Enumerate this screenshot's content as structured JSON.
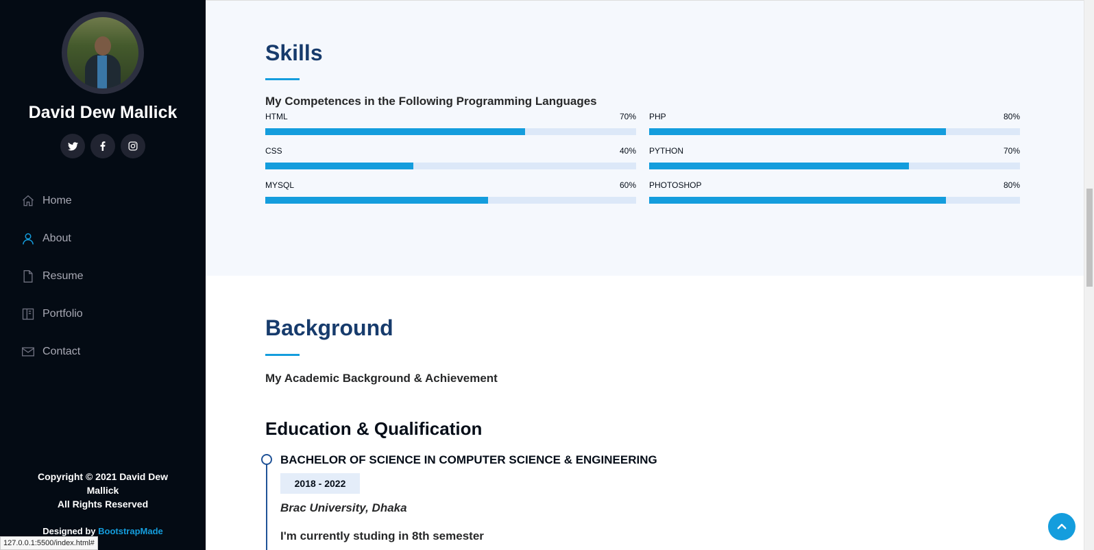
{
  "sidebar": {
    "name": "David Dew Mallick",
    "social": [
      {
        "name": "twitter",
        "glyph": "t"
      },
      {
        "name": "facebook",
        "glyph": "f"
      },
      {
        "name": "instagram",
        "glyph": "◎"
      }
    ],
    "nav": [
      {
        "label": "Home",
        "icon": "house-icon"
      },
      {
        "label": "About",
        "icon": "person-icon",
        "active": true
      },
      {
        "label": "Resume",
        "icon": "file-icon"
      },
      {
        "label": "Portfolio",
        "icon": "book-icon"
      },
      {
        "label": "Contact",
        "icon": "envelope-icon"
      }
    ],
    "copyright_line1": "Copyright © 2021 David Dew",
    "copyright_line2": "Mallick",
    "copyright_line3": "All Rights Reserved",
    "designed_by_prefix": "Designed by ",
    "designed_by_link": "BootstrapMade"
  },
  "skills": {
    "title": "Skills",
    "subtitle": "My Competences in the Following Programming Languages",
    "items": [
      {
        "name": "HTML",
        "percent_label": "70%",
        "level": 0.7
      },
      {
        "name": "PHP",
        "percent_label": "80%",
        "level": 0.8
      },
      {
        "name": "CSS",
        "percent_label": "40%",
        "level": 0.4
      },
      {
        "name": "PYTHON",
        "percent_label": "70%",
        "level": 0.7
      },
      {
        "name": "MYSQL",
        "percent_label": "60%",
        "level": 0.6
      },
      {
        "name": "PHOTOSHOP",
        "percent_label": "80%",
        "level": 0.8
      }
    ]
  },
  "background": {
    "title": "Background",
    "subtitle": "My Academic Background & Achievement",
    "education_title": "Education & Qualification",
    "degree": "BACHELOR OF SCIENCE IN COMPUTER SCIENCE & ENGINEERING",
    "years": "2018 - 2022",
    "institution": "Brac University, Dhaka",
    "description": "I'm currently studing in 8th semester"
  },
  "status_url": "127.0.0.1:5500/index.html#"
}
